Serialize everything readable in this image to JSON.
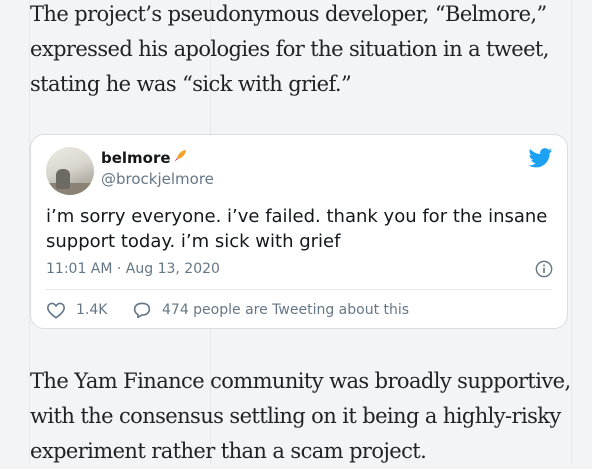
{
  "article": {
    "paragraph_1": "The project’s pseudonymous developer, “Belmore,” expressed his apologies for the situation in a tweet, stating he was “sick with grief.”",
    "paragraph_2": "The Yam Finance community was broadly supportive, with the consensus settling on it being a highly-risky experiment rather than a scam project."
  },
  "tweet": {
    "display_name": "belmore",
    "name_emoji": "rocket-emoji",
    "handle": "@brockjelmore",
    "text": "i’m sorry everyone. i’ve failed. thank you for the insane support today. i’m sick with grief",
    "timestamp": "11:01 AM · Aug 13, 2020",
    "like_count": "1.4K",
    "tweeting_text": "474 people are Tweeting about this",
    "icons": {
      "logo": "twitter-bird-icon",
      "info": "info-icon",
      "like": "heart-icon",
      "reply": "speech-bubble-icon"
    },
    "colors": {
      "brand": "#1da1f2",
      "muted": "#657786",
      "text": "#14171a"
    }
  }
}
